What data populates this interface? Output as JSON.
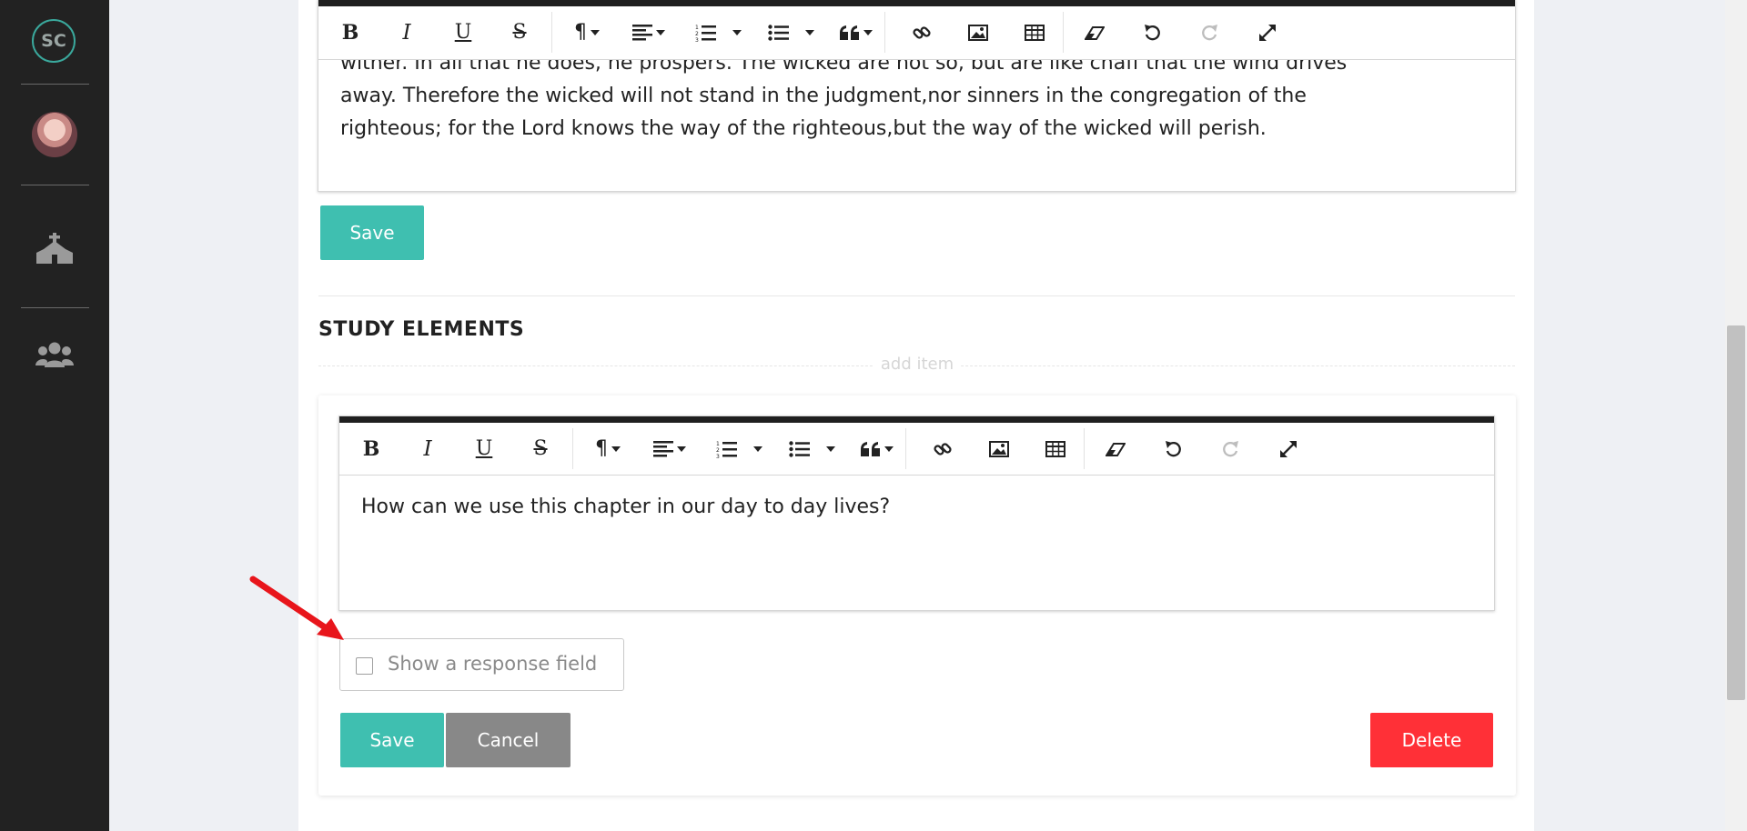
{
  "sidebar": {
    "logo_text": "SC",
    "items": [
      {
        "icon": "user-avatar"
      },
      {
        "icon": "church-icon"
      },
      {
        "icon": "users-icon"
      }
    ]
  },
  "editor_top": {
    "text_lines": [
      "wither. In all that he does, he prospers. The wicked are not so, but are like chaff that the wind drives",
      "away. Therefore the wicked will not stand in the judgment,nor sinners in the congregation of the",
      "righteous; for the Lord knows the way of the righteous,but the way of the wicked will perish."
    ],
    "save_label": "Save"
  },
  "toolbar": {
    "bold": "B",
    "italic": "I",
    "underline": "U",
    "strike": "S",
    "paragraph": "¶"
  },
  "section": {
    "heading": "STUDY ELEMENTS",
    "add_item": "add item"
  },
  "study_element": {
    "text": "How can we use this chapter in our day to day lives?",
    "response_checkbox_label": "Show a response field",
    "response_checked": false,
    "save_label": "Save",
    "cancel_label": "Cancel",
    "delete_label": "Delete"
  },
  "colors": {
    "sidebar_bg": "#222222",
    "accent_teal": "#3fbfb0",
    "cancel_grey": "#888888",
    "delete_red": "#ff3037",
    "annotation_arrow": "#e8151b"
  }
}
